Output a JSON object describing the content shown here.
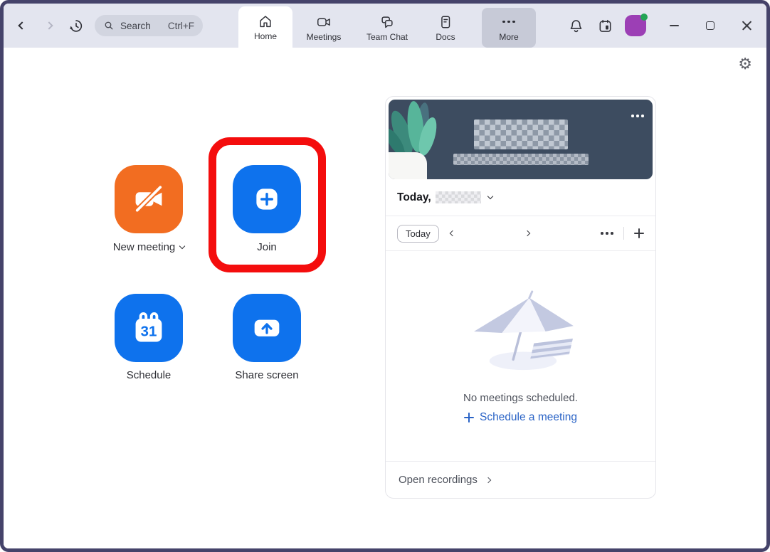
{
  "titlebar": {
    "search_label": "Search",
    "search_shortcut": "Ctrl+F",
    "tabs": [
      {
        "label": "Home",
        "active": true
      },
      {
        "label": "Meetings",
        "active": false
      },
      {
        "label": "Team Chat",
        "active": false
      },
      {
        "label": "Docs",
        "active": false
      },
      {
        "label": "More",
        "active": false
      }
    ]
  },
  "actions": {
    "new_meeting_label": "New meeting",
    "join_label": "Join",
    "schedule_label": "Schedule",
    "share_screen_label": "Share screen",
    "schedule_day": "31"
  },
  "panel": {
    "today_prefix": "Today,",
    "today_button": "Today",
    "no_meetings_text": "No meetings scheduled.",
    "schedule_link_label": "Schedule a meeting",
    "open_recordings_label": "Open recordings"
  },
  "colors": {
    "accent": "#0E72ED",
    "orange": "#F26D21",
    "annotation": "#F40D0D",
    "banner": "#3D4C60",
    "link": "#2A63C6",
    "avatar": "#9C3FB5",
    "presence": "#23A455",
    "titlebar-bg": "#E3E5EF",
    "window-border": "#45436A"
  }
}
